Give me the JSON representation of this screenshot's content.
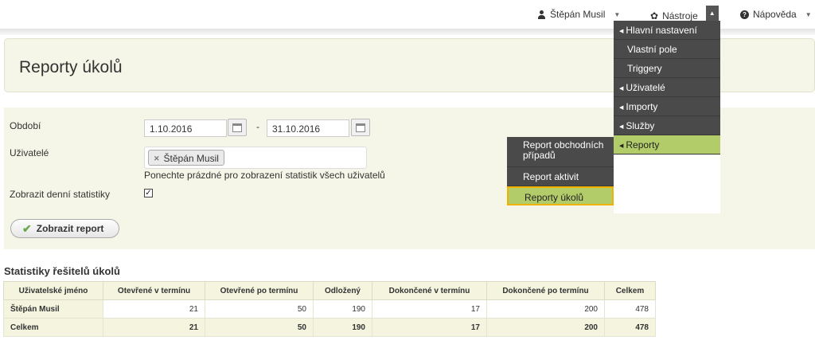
{
  "topbar": {
    "user": "Štěpán Musil",
    "tools": "Nástroje",
    "help": "Nápověda"
  },
  "page_title": "Reporty úkolů",
  "form": {
    "period_label": "Období",
    "date_from": "1.10.2016",
    "date_separator": "-",
    "date_to": "31.10.2016",
    "users_label": "Uživatelé",
    "selected_user": "Štěpán Musil",
    "users_hint": "Ponechte prázdné pro zobrazení statistik všech uživatelů",
    "daily_stats_label": "Zobrazit denní statistiky",
    "daily_stats_checked": true,
    "submit_label": "Zobrazit report"
  },
  "stats": {
    "title": "Statistiky řešitelů úkolů",
    "headers": [
      "Uživatelské jméno",
      "Otevřené v termínu",
      "Otevřené po termínu",
      "Odložený",
      "Dokončené v termínu",
      "Dokončené po termínu",
      "Celkem"
    ],
    "rows": [
      [
        "Štěpán Musil",
        "21",
        "50",
        "190",
        "17",
        "200",
        "478"
      ]
    ],
    "total": [
      "Celkem",
      "21",
      "50",
      "190",
      "17",
      "200",
      "478"
    ]
  },
  "tools_menu": {
    "items": [
      {
        "label": "Hlavní nastavení",
        "has_submenu": true
      },
      {
        "label": "Vlastní pole",
        "has_submenu": false
      },
      {
        "label": "Triggery",
        "has_submenu": false
      },
      {
        "label": "Uživatelé",
        "has_submenu": true
      },
      {
        "label": "Importy",
        "has_submenu": true
      },
      {
        "label": "Služby",
        "has_submenu": true
      },
      {
        "label": "Reporty",
        "has_submenu": true,
        "active": true
      }
    ]
  },
  "reports_submenu": {
    "items": [
      {
        "label": "Report obchodních případů"
      },
      {
        "label": "Report aktivit"
      },
      {
        "label": "Reporty úkolů",
        "active": true
      }
    ]
  },
  "colors": {
    "panel_bg": "#f6f6e8",
    "menu_bg": "#4a4a4a",
    "menu_active": "#b3cc6a",
    "highlight_border": "#f0b400"
  }
}
